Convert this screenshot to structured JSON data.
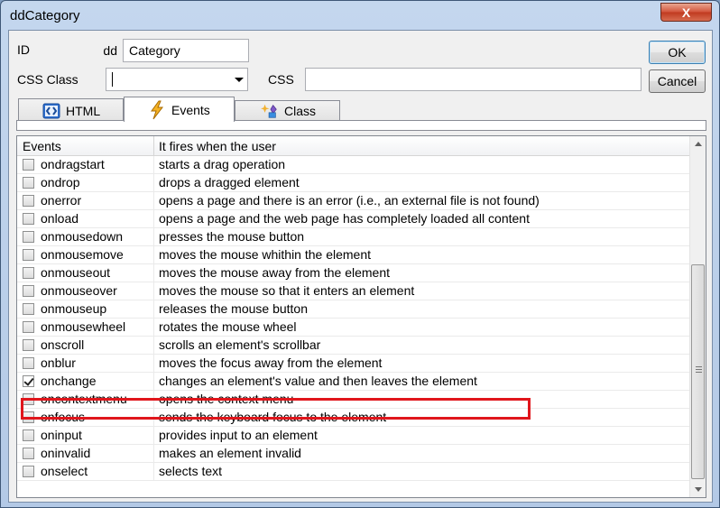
{
  "window": {
    "title": "ddCategory",
    "close_label": "X"
  },
  "form": {
    "id_label": "ID",
    "id_prefix": "dd",
    "id_value": "Category",
    "css_class_label": "CSS Class",
    "css_class_value": "",
    "css_label": "CSS",
    "css_value": ""
  },
  "buttons": {
    "ok": "OK",
    "cancel": "Cancel"
  },
  "tabs": [
    {
      "label": "HTML",
      "icon": "code-brackets-icon",
      "active": false
    },
    {
      "label": "Events",
      "icon": "lightning-icon",
      "active": true
    },
    {
      "label": "Class",
      "icon": "class-sparkle-icon",
      "active": false
    }
  ],
  "grid": {
    "headers": [
      "Events",
      "It fires when the user"
    ],
    "rows": [
      {
        "event": "ondragstart",
        "desc": "starts a drag operation",
        "checked": false
      },
      {
        "event": "ondrop",
        "desc": "drops a dragged element",
        "checked": false
      },
      {
        "event": "onerror",
        "desc": "opens a page and there is an error (i.e., an external file is not found)",
        "checked": false
      },
      {
        "event": "onload",
        "desc": "opens a page and  the web page has completely loaded all content",
        "checked": false
      },
      {
        "event": "onmousedown",
        "desc": "presses the mouse button",
        "checked": false
      },
      {
        "event": "onmousemove",
        "desc": "moves the mouse whithin the element",
        "checked": false
      },
      {
        "event": "onmouseout",
        "desc": "moves the mouse away from the element",
        "checked": false
      },
      {
        "event": "onmouseover",
        "desc": "moves the mouse so that it enters an element",
        "checked": false
      },
      {
        "event": "onmouseup",
        "desc": "releases the mouse button",
        "checked": false
      },
      {
        "event": "onmousewheel",
        "desc": "rotates the mouse wheel",
        "checked": false
      },
      {
        "event": "onscroll",
        "desc": "scrolls an element's scrollbar",
        "checked": false
      },
      {
        "event": "onblur",
        "desc": "moves the focus away from the element",
        "checked": false
      },
      {
        "event": "onchange",
        "desc": "changes an element's value and then leaves the element",
        "checked": true
      },
      {
        "event": "oncontextmenu",
        "desc": "opens the context menu",
        "checked": false
      },
      {
        "event": "onfocus",
        "desc": "sends the keyboard focus to the element",
        "checked": false
      },
      {
        "event": "oninput",
        "desc": "provides input to an element",
        "checked": false
      },
      {
        "event": "oninvalid",
        "desc": "makes an element invalid",
        "checked": false
      },
      {
        "event": "onselect",
        "desc": "selects text",
        "checked": false
      }
    ]
  },
  "colors": {
    "highlight_border": "#e0161c"
  }
}
